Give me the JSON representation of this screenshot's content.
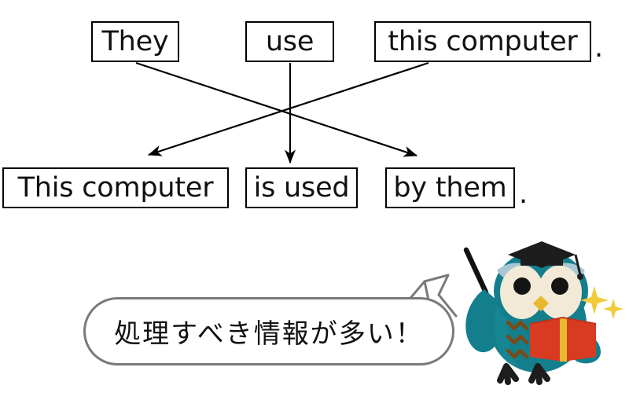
{
  "diagram": {
    "title": "English passive voice transformation diagram",
    "top_row": [
      {
        "id": "they",
        "text": "They"
      },
      {
        "id": "use",
        "text": "use"
      },
      {
        "id": "this-computer",
        "text": "this computer"
      }
    ],
    "top_row_punctuation": ".",
    "bottom_row": [
      {
        "id": "this-computer",
        "text": "This computer"
      },
      {
        "id": "is-used",
        "text": "is used"
      },
      {
        "id": "by-them",
        "text": "by them"
      }
    ],
    "bottom_row_punctuation": ".",
    "arrows": [
      {
        "id": "arrow-they-to-by-them",
        "from": "They",
        "to": "by them",
        "direction": "down-right"
      },
      {
        "id": "arrow-use-to-is-used",
        "from": "use",
        "to": "is used",
        "direction": "down"
      },
      {
        "id": "arrow-this-computer-to-subject",
        "from": "this computer",
        "to": "This computer",
        "direction": "down-left"
      }
    ]
  },
  "speech_bubble": {
    "text": "処理すべき情報が多い！",
    "border_color": "#7a7a7a",
    "fill_color": "#ffffff"
  },
  "mascot": {
    "name": "owl-professor",
    "accessories": [
      "graduation-cap",
      "open-book",
      "pointer-stick",
      "sparkles"
    ],
    "colors": {
      "body": "#147f8c",
      "body_shadow": "#0f6a75",
      "wing": "#126f7c",
      "face": "#f2ead7",
      "eye": "#141414",
      "beak": "#e8b92e",
      "cap": "#1d1d1d",
      "book": "#d93a22",
      "book_spine": "#e8b92e",
      "chest_marks": "#7a4a18",
      "sparkle": "#f0cc3c",
      "brow": "#a9c6d4",
      "pointer": "#111111"
    }
  }
}
